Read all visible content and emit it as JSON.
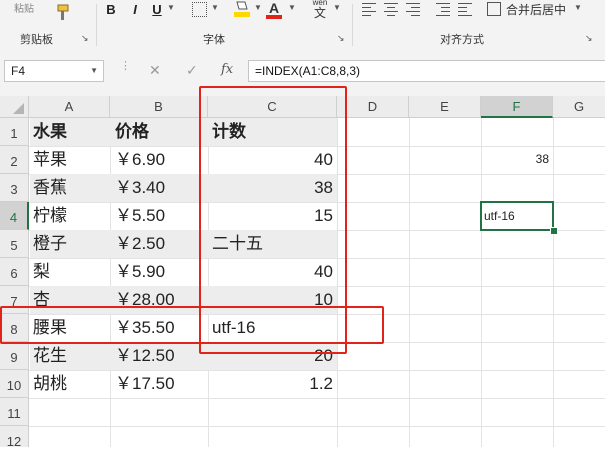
{
  "ribbon": {
    "paste_label": "粘贴",
    "clipboard_label": "剪贴板",
    "font_label": "字体",
    "align_label": "对齐方式",
    "bold": "B",
    "italic": "I",
    "underline": "U",
    "font_color_letter": "A",
    "wen_top": "wén",
    "wen_char": "文",
    "merge_label": "合并后居中",
    "colors": {
      "highlight": "#ffd800",
      "font_color": "#e2231a"
    }
  },
  "formula_bar": {
    "name_box": "F4",
    "cancel_icon": "✕",
    "enter_icon": "✓",
    "fx_label": "fx",
    "formula": "=INDEX(A1:C8,8,3)"
  },
  "columns": [
    "A",
    "B",
    "C",
    "D",
    "E",
    "F",
    "G"
  ],
  "rows": [
    "1",
    "2",
    "3",
    "4",
    "5",
    "6",
    "7",
    "8",
    "9",
    "10",
    "11",
    "12"
  ],
  "table": [
    {
      "a": "水果",
      "b": "价格",
      "c": "计数"
    },
    {
      "a": "苹果",
      "b": "￥6.90",
      "c": "40"
    },
    {
      "a": "香蕉",
      "b": "￥3.40",
      "c": "38"
    },
    {
      "a": "柠檬",
      "b": "￥5.50",
      "c": "15"
    },
    {
      "a": "橙子",
      "b": "￥2.50",
      "c": "二十五"
    },
    {
      "a": "梨",
      "b": "￥5.90",
      "c": "40"
    },
    {
      "a": "杏",
      "b": "￥28.00",
      "c": "10"
    },
    {
      "a": "腰果",
      "b": "￥35.50",
      "c": "utf-16"
    },
    {
      "a": "花生",
      "b": "￥12.50",
      "c": "20"
    },
    {
      "a": "胡桃",
      "b": "￥17.50",
      "c": "1.2"
    }
  ],
  "other_cells": {
    "f2": "38",
    "f4": "utf-16"
  },
  "selected_cell": "F4",
  "accent_colors": {
    "selection": "#217346",
    "annotation": "#e2231a",
    "table_shade": "#ededed"
  }
}
